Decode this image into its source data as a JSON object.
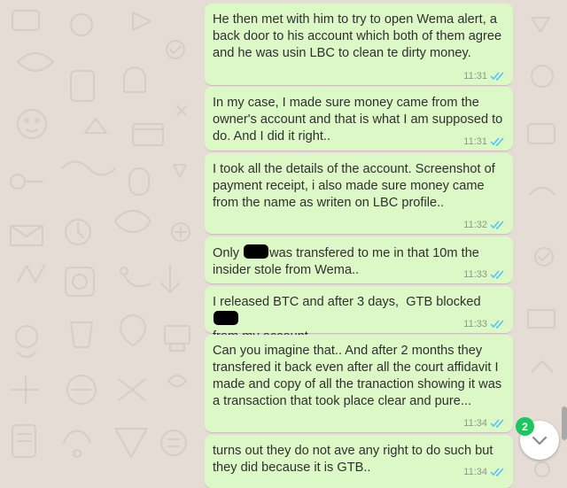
{
  "messages": [
    {
      "text": "He then met with him to try to open Wema alert, a back door to his account which both of them agree and he was usin LBC to clean te dirty money.",
      "time": "11:31"
    },
    {
      "text": "In my case, I made sure money came from the owner's account and that is what I am supposed to do. And I did it right..",
      "time": "11:31"
    },
    {
      "text": "I took all the details of the account. Screenshot of payment receipt, i also made sure money came from the name as writen on LBC profile..",
      "time": "11:32"
    },
    {
      "text_before": "Only ",
      "text_after": "was transfered to me in that 10m the insider stole from Wema..",
      "time": "11:33"
    },
    {
      "text_before": "I released BTC and after 3 days,  GTB blocked ",
      "text_after": "\nfrom my account",
      "time": "11:33"
    },
    {
      "text": "Can you imagine that.. And after 2 months they transfered it back even after all the court affidavit I made and copy of all the tranaction showing it was  a transaction that took place clear and pure...",
      "time": "11:34"
    },
    {
      "text": "turns out they do not ave any right to do such but they did because it is GTB..",
      "time": "11:34"
    }
  ],
  "scroll_down": {
    "unread_count": "2",
    "icon": "chevron-down-icon"
  },
  "colors": {
    "bubble": "#dcf8c6",
    "background": "#e5ddd5",
    "tick": "#4fc3f7",
    "badge": "#1fc55f"
  }
}
